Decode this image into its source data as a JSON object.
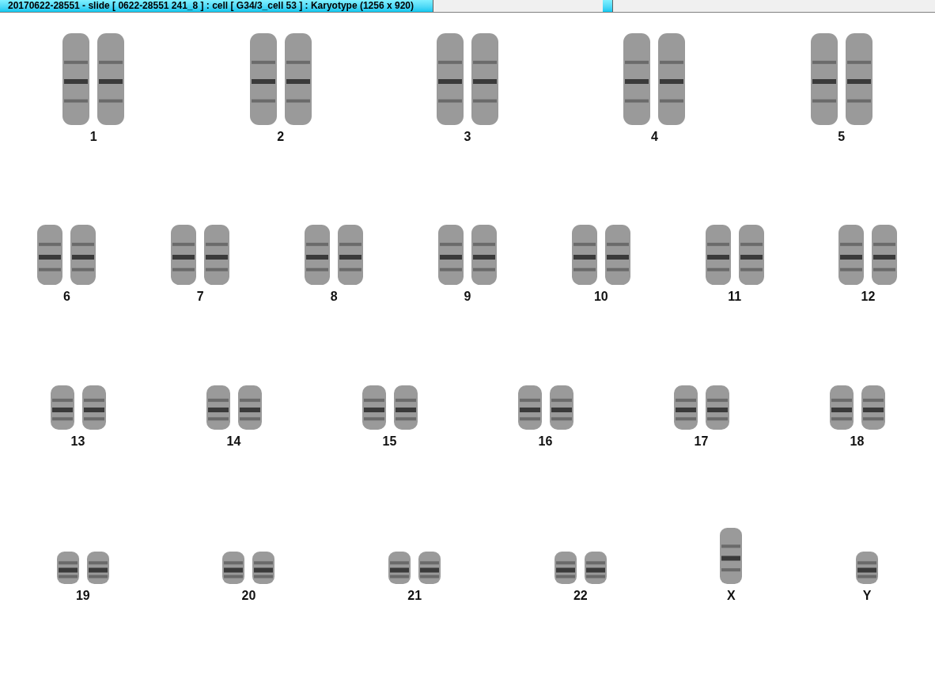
{
  "window": {
    "title": "20170622-28551 - slide [ 0622-28551 241_8 ] : cell [ G34/3_cell 53 ] : Karyotype  (1256 x 920)"
  },
  "rows": [
    {
      "chromosomes": [
        {
          "label": "1",
          "kind": "pair"
        },
        {
          "label": "2",
          "kind": "pair"
        },
        {
          "label": "3",
          "kind": "pair"
        },
        {
          "label": "4",
          "kind": "pair"
        },
        {
          "label": "5",
          "kind": "pair"
        }
      ]
    },
    {
      "chromosomes": [
        {
          "label": "6",
          "kind": "pair"
        },
        {
          "label": "7",
          "kind": "pair"
        },
        {
          "label": "8",
          "kind": "pair"
        },
        {
          "label": "9",
          "kind": "pair"
        },
        {
          "label": "10",
          "kind": "pair"
        },
        {
          "label": "11",
          "kind": "pair"
        },
        {
          "label": "12",
          "kind": "pair"
        }
      ]
    },
    {
      "chromosomes": [
        {
          "label": "13",
          "kind": "pair"
        },
        {
          "label": "14",
          "kind": "pair"
        },
        {
          "label": "15",
          "kind": "pair"
        },
        {
          "label": "16",
          "kind": "pair"
        },
        {
          "label": "17",
          "kind": "pair"
        },
        {
          "label": "18",
          "kind": "pair"
        }
      ]
    },
    {
      "chromosomes": [
        {
          "label": "19",
          "kind": "pair"
        },
        {
          "label": "20",
          "kind": "pair"
        },
        {
          "label": "21",
          "kind": "pair"
        },
        {
          "label": "22",
          "kind": "pair"
        },
        {
          "label": "X",
          "kind": "single"
        },
        {
          "label": "Y",
          "kind": "single"
        }
      ]
    }
  ]
}
